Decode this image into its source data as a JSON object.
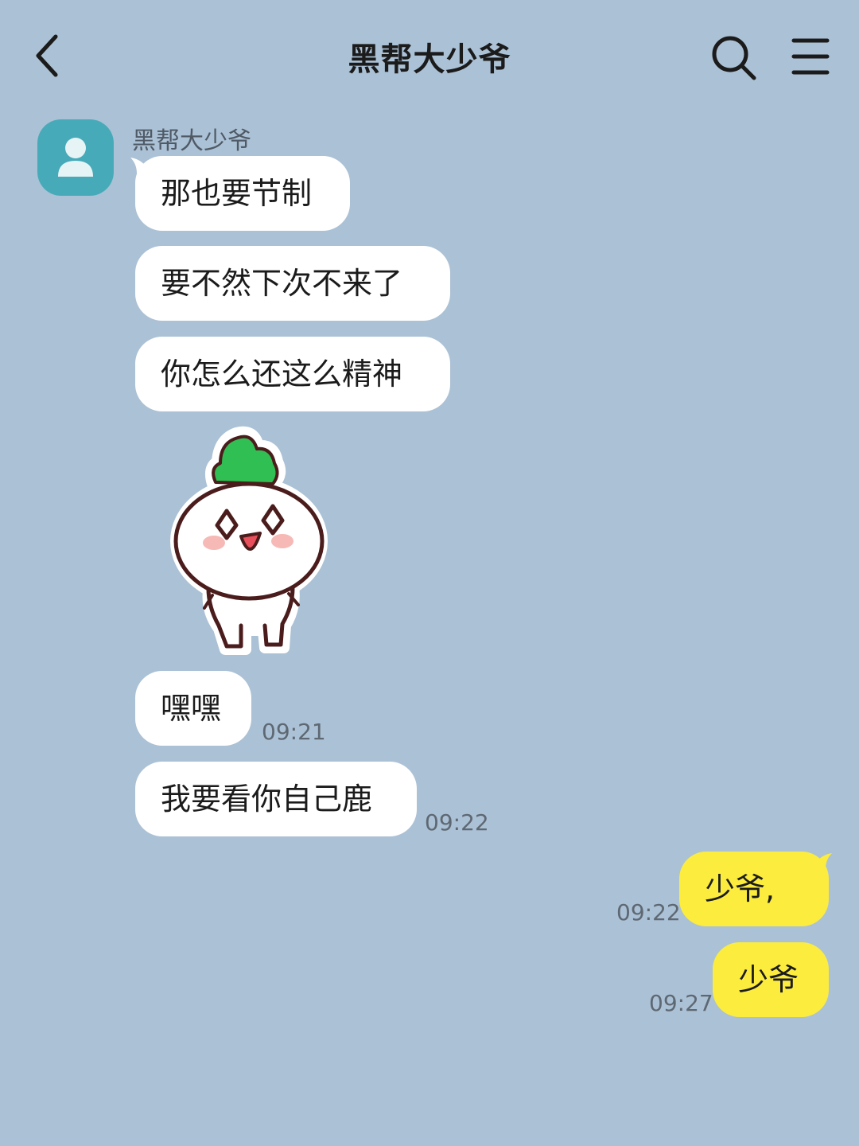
{
  "header": {
    "title": "黑帮大少爷",
    "back_icon": "chevron-left-icon",
    "search_icon": "search-icon",
    "menu_icon": "hamburger-menu-icon"
  },
  "contact": {
    "name": "黑帮大少爷",
    "avatar_icon": "person-icon",
    "avatar_color": "#47aab8"
  },
  "messages": [
    {
      "from": "them",
      "text": "那也要节制"
    },
    {
      "from": "them",
      "text": "要不然下次不来了"
    },
    {
      "from": "them",
      "text": "你怎么还这么精神"
    },
    {
      "from": "them",
      "type": "sticker",
      "icon": "radish-sticker-icon"
    },
    {
      "from": "them",
      "text": "嘿嘿",
      "time": "09:21"
    },
    {
      "from": "them",
      "text": "我要看你自己鹿",
      "time": "09:22"
    },
    {
      "from": "me",
      "text": "少爷,",
      "time": "09:22"
    },
    {
      "from": "me",
      "text": "少爷",
      "time": "09:27"
    }
  ],
  "colors": {
    "background": "#abc1d5",
    "incoming_bubble": "#ffffff",
    "outgoing_bubble": "#fbec3e"
  }
}
